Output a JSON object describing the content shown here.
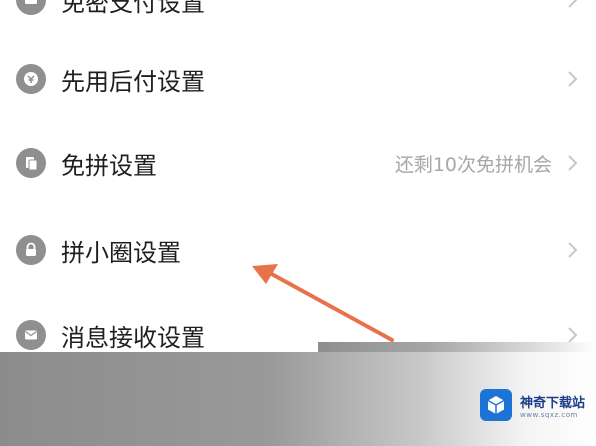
{
  "settings": {
    "items": [
      {
        "label": "免密支付设置",
        "value": "",
        "icon": "payment-icon"
      },
      {
        "label": "先用后付设置",
        "value": "",
        "icon": "pay-later-icon"
      },
      {
        "label": "免拼设置",
        "value": "还剩10次免拼机会",
        "icon": "free-group-icon"
      },
      {
        "label": "拼小圈设置",
        "value": "",
        "icon": "lock-icon"
      },
      {
        "label": "消息接收设置",
        "value": "",
        "icon": "message-icon"
      }
    ]
  },
  "annotation": {
    "arrow_color": "#e8734a"
  },
  "watermark": {
    "title": "神奇下载站",
    "url": "www.sqxz.com"
  },
  "colors": {
    "icon": "#8f8f8f",
    "text": "#1f1f1f",
    "secondary": "#a7a7a7",
    "chevron": "#c8c8c8"
  }
}
